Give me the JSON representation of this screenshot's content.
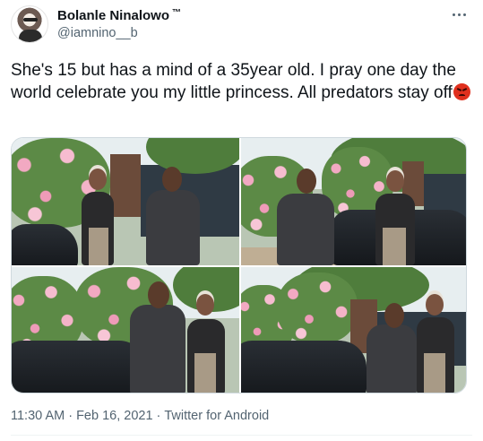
{
  "tweet": {
    "author": {
      "display_name": "Bolanle Ninalowo",
      "trademark": "™",
      "handle": "@iamnino__b"
    },
    "text": "She's 15 but has a mind of a 35year old. I pray one day the world celebrate you my little princess. All predators stay off",
    "emoji": "pouting-face",
    "media": [
      {
        "alt": "photo-1"
      },
      {
        "alt": "photo-2"
      },
      {
        "alt": "photo-3"
      },
      {
        "alt": "photo-4"
      }
    ],
    "timestamp": "11:30 AM · Feb 16, 2021",
    "separator": "·",
    "source": "Twitter for Android"
  },
  "colors": {
    "text_primary": "#0f1419",
    "text_secondary": "#536471",
    "border": "#cfd9de"
  }
}
